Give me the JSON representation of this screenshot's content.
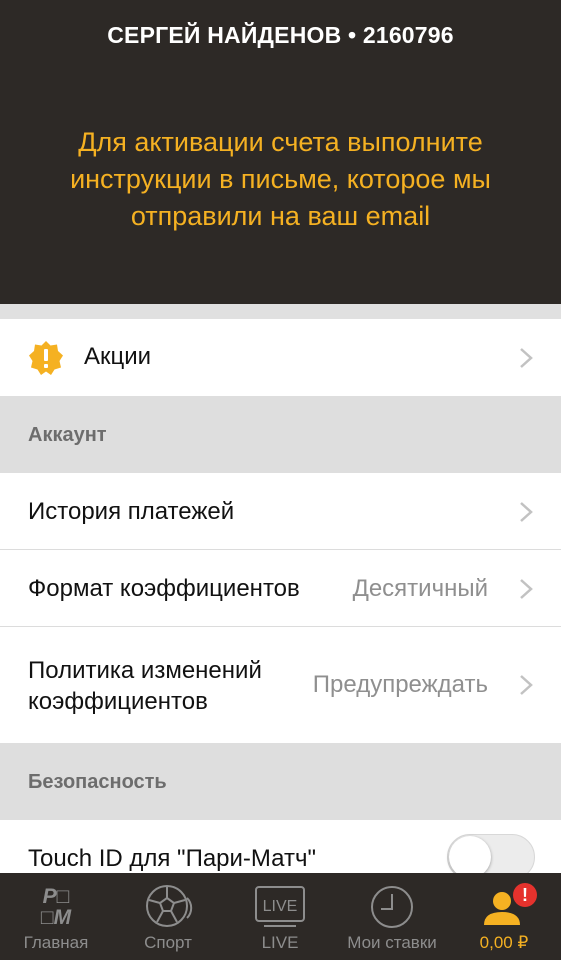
{
  "header": {
    "user_line": "СЕРГЕЙ НАЙДЕНОВ • 2160796",
    "notice": "Для активации счета выполните инструкции в письме, которое мы отправили на ваш email"
  },
  "promo": {
    "label": "Акции",
    "icon": "exclamation-badge-icon"
  },
  "sections": {
    "account": "Аккаунт",
    "security": "Безопасность"
  },
  "account_rows": {
    "payment_history": "История платежей",
    "odds_format": {
      "label": "Формат коэффициентов",
      "value": "Десятичный"
    },
    "odds_policy": {
      "label": "Политика изменений коэффициентов",
      "value": "Предупреждать"
    }
  },
  "security_rows": {
    "touch_id": {
      "label": "Touch ID для \"Пари-Матч\"",
      "enabled": false
    }
  },
  "tabbar": {
    "tabs": [
      {
        "label": "Главная",
        "icon": "pm-logo-icon"
      },
      {
        "label": "Спорт",
        "icon": "ball-icon"
      },
      {
        "label": "LIVE",
        "icon": "live-icon",
        "icon_text": "LIVE"
      },
      {
        "label": "Мои ставки",
        "icon": "clock-icon"
      },
      {
        "label": "0,00 ₽",
        "icon": "account-icon",
        "badge": "!"
      }
    ]
  },
  "colors": {
    "header_bg": "#2d2926",
    "accent": "#f5b122",
    "badge_red": "#e5322d"
  }
}
